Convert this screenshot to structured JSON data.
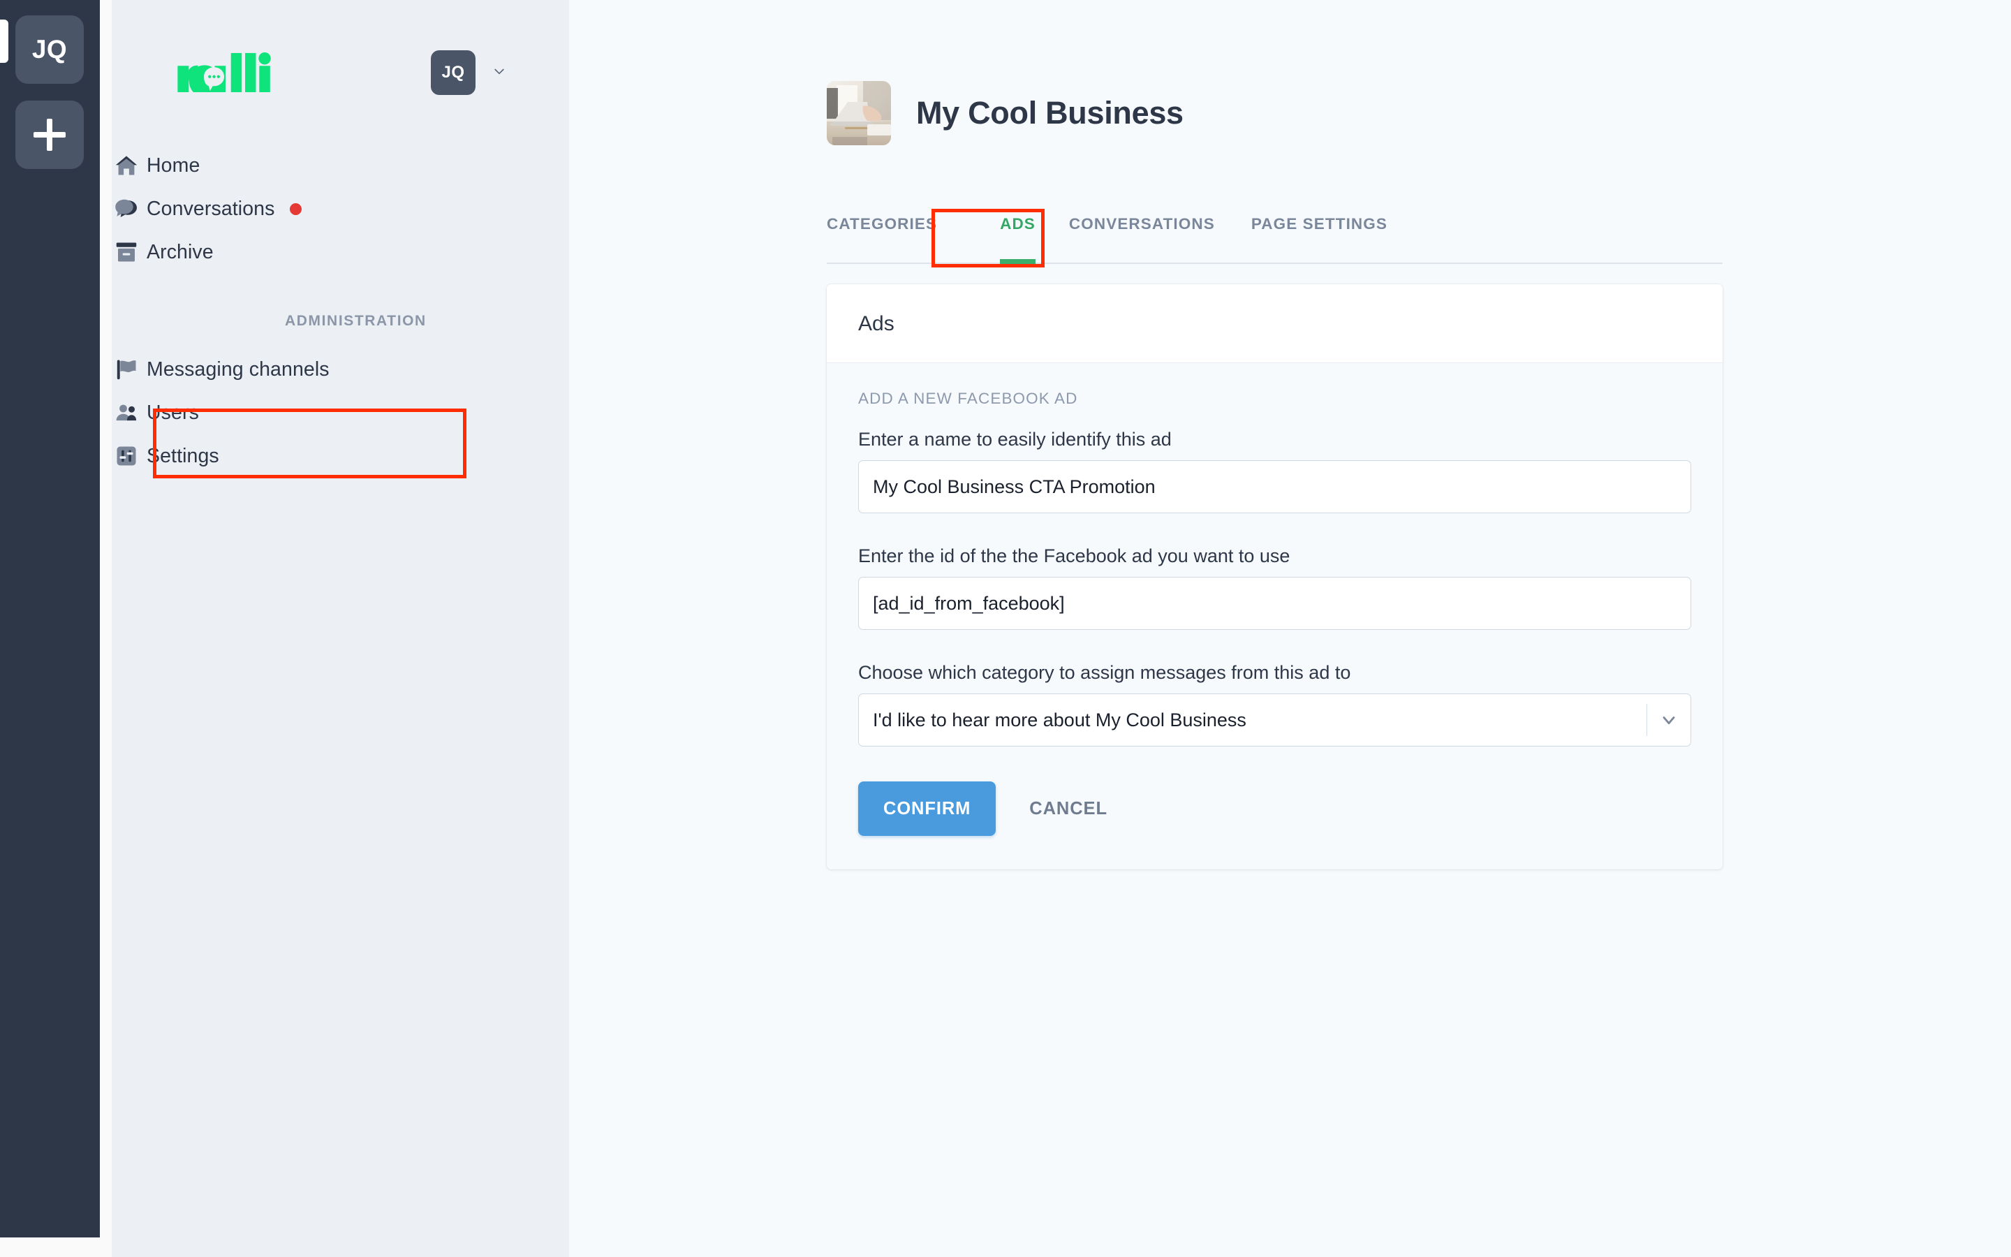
{
  "rail": {
    "workspace_initials": "JQ",
    "add_workspace_label": "+",
    "bg_color": "#2d3748",
    "tile_color": "#4a5568"
  },
  "sidebar": {
    "brand": "ralli",
    "brand_color": "#0ee37c",
    "account_initials": "JQ",
    "nav": [
      {
        "label": "Home",
        "icon": "home-icon",
        "badge": null
      },
      {
        "label": "Conversations",
        "icon": "chat-bubbles-icon",
        "badge": "unread-dot"
      },
      {
        "label": "Archive",
        "icon": "archive-box-icon",
        "badge": null
      }
    ],
    "section_title": "ADMINISTRATION",
    "admin_nav": [
      {
        "label": "Messaging channels",
        "icon": "flag-icon",
        "highlighted": true
      },
      {
        "label": "Users",
        "icon": "people-icon",
        "highlighted": false
      },
      {
        "label": "Settings",
        "icon": "sliders-icon",
        "highlighted": false
      }
    ]
  },
  "main": {
    "page_title": "My Cool Business",
    "thumbnail_alt": "business-photo-thumbnail",
    "tabs": [
      {
        "label": "CATEGORIES",
        "active": false
      },
      {
        "label": "ADS",
        "active": true
      },
      {
        "label": "CONVERSATIONS",
        "active": false
      },
      {
        "label": "PAGE SETTINGS",
        "active": false
      }
    ],
    "active_tab_color": "#33a864",
    "card": {
      "header_title": "Ads",
      "kicker": "ADD A NEW FACEBOOK AD",
      "fields": [
        {
          "label": "Enter a name to easily identify this ad",
          "value": "My Cool Business CTA Promotion",
          "placeholder": "Enter a name to easily identify this ad"
        },
        {
          "label": "Enter the id of the the Facebook ad you want to use",
          "value": "[ad_id_from_facebook]",
          "placeholder": "[ad_id_from_facebook]"
        }
      ],
      "select": {
        "label": "Choose which category to assign messages from this ad to",
        "value": "I'd like to hear more about My Cool Business"
      },
      "confirm_label": "CONFIRM",
      "cancel_label": "CANCEL",
      "confirm_color": "#4a9ade"
    }
  },
  "annotations": {
    "highlight_color": "#ff2d00",
    "boxes": [
      {
        "target": "sidebar-item-messaging-channels"
      },
      {
        "target": "tab-ads"
      }
    ]
  }
}
